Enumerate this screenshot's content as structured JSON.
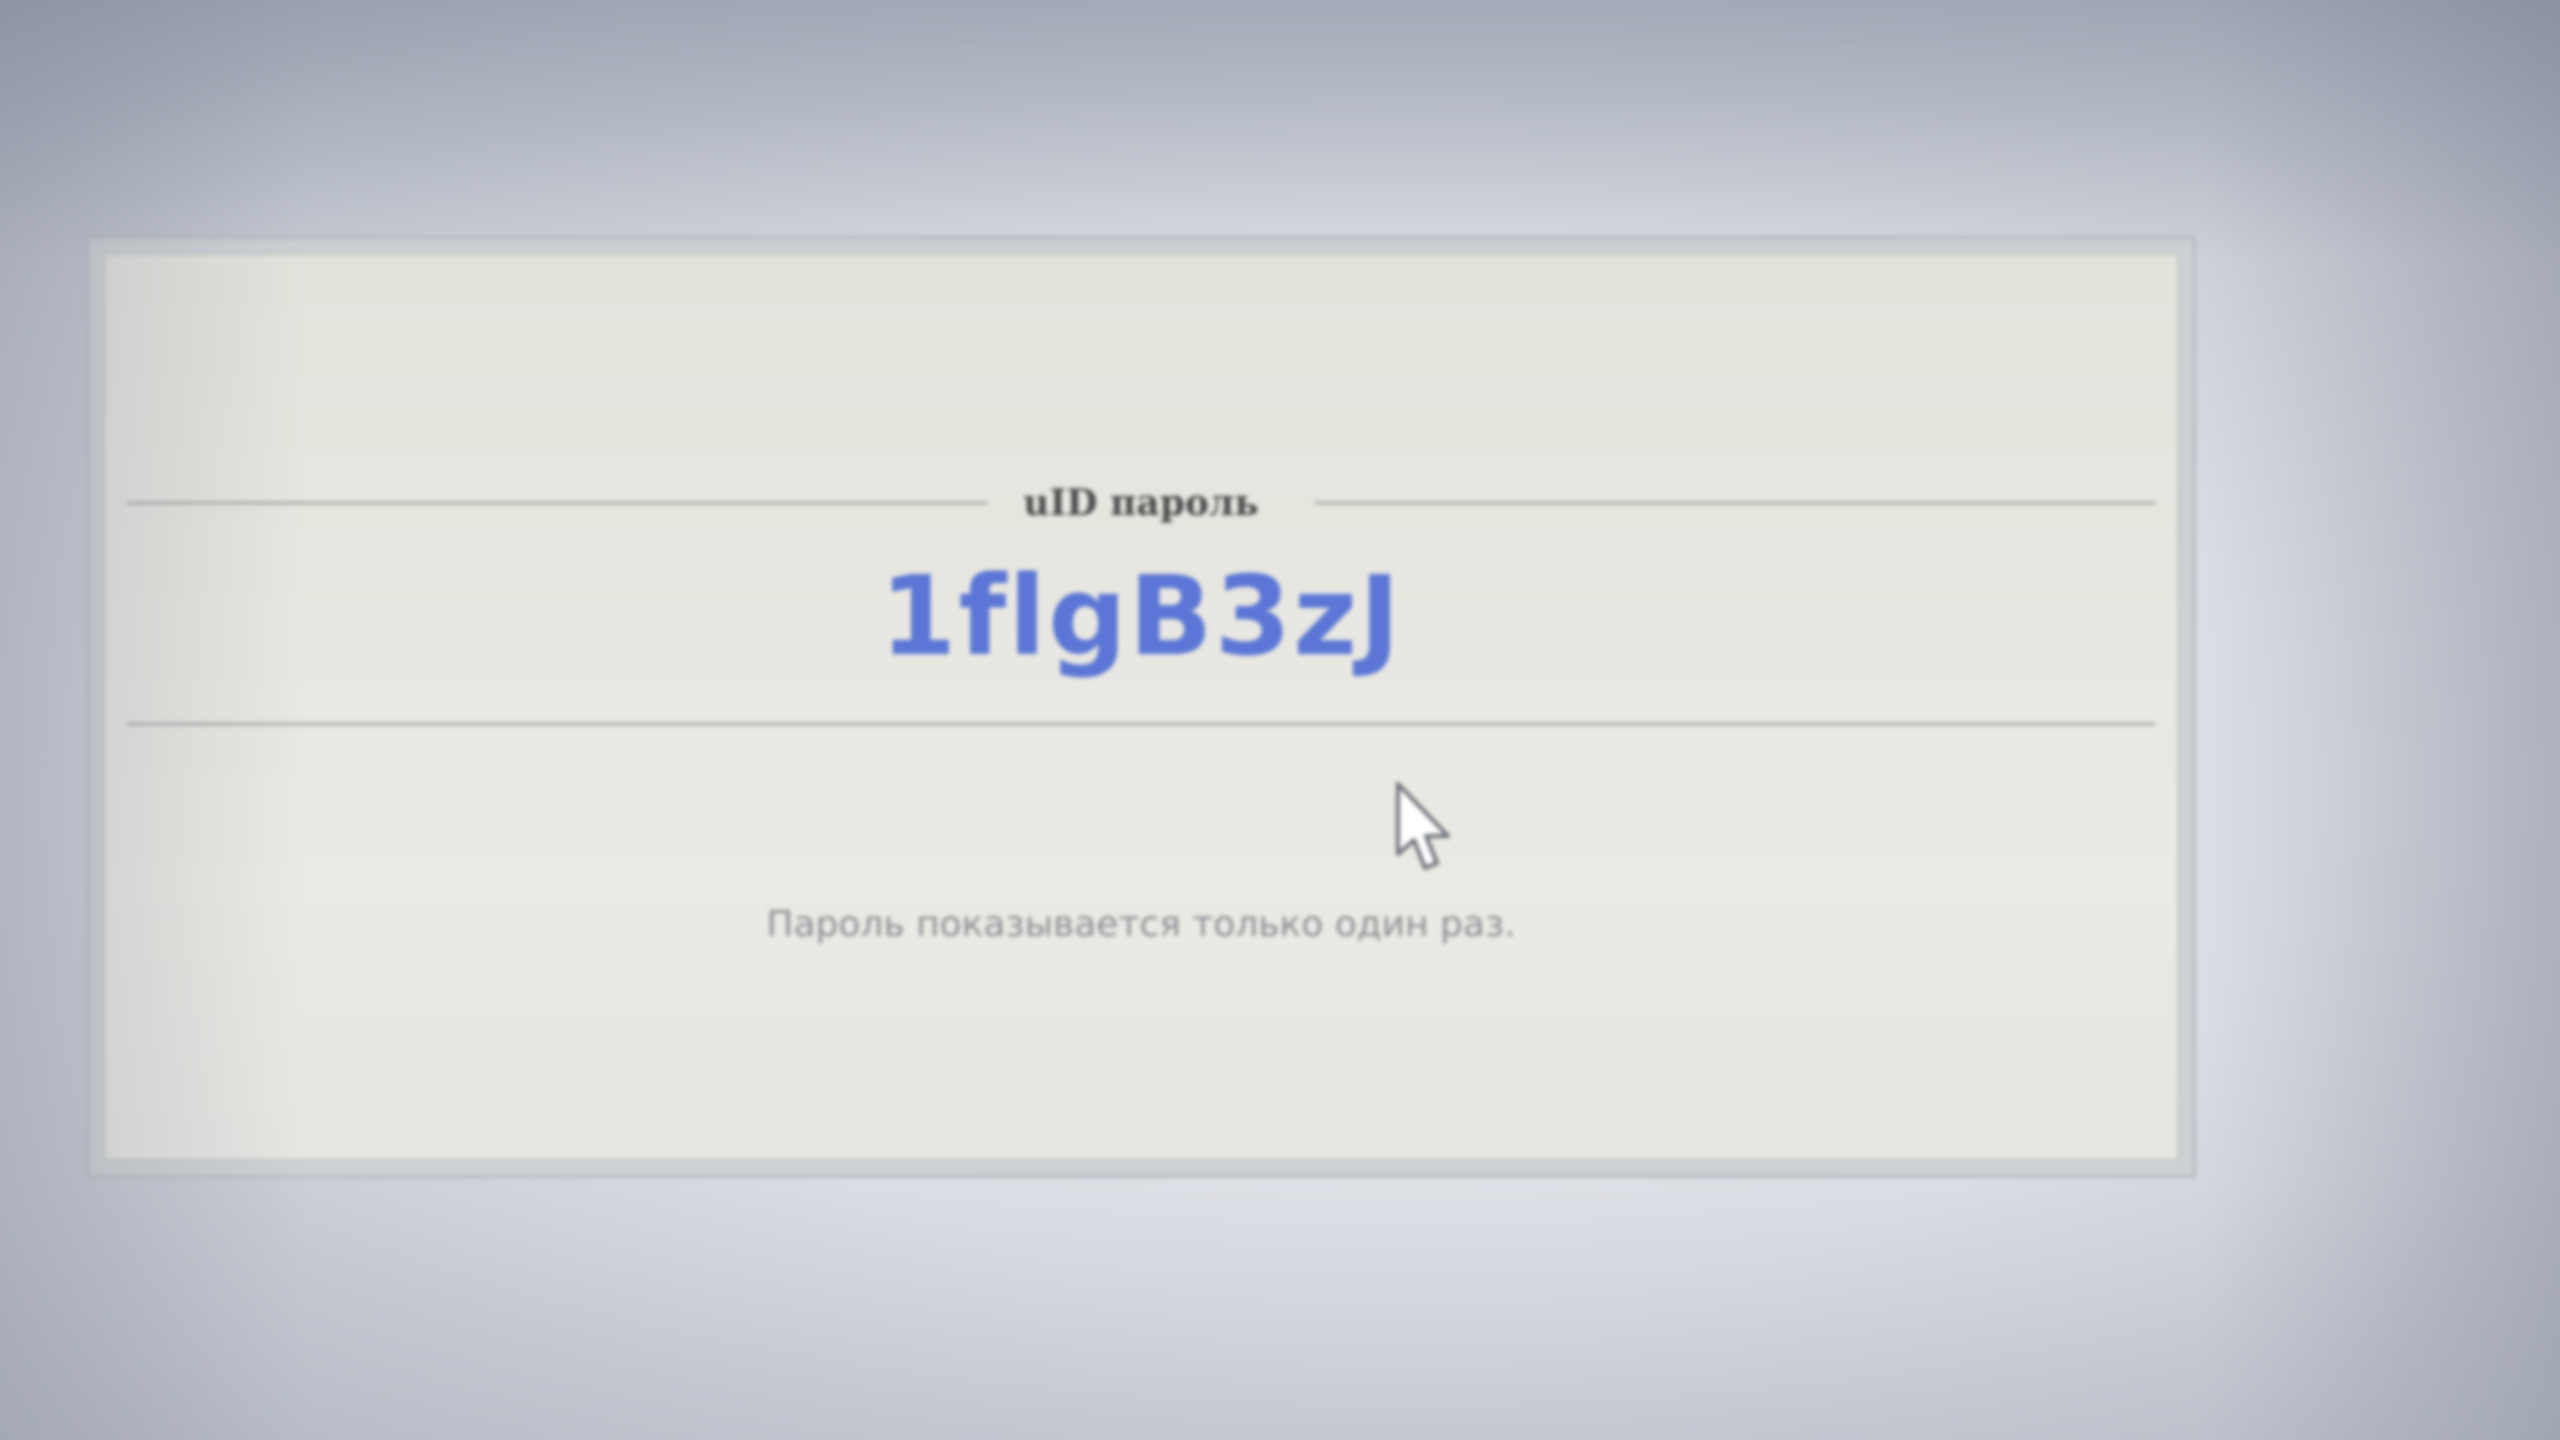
{
  "dialog": {
    "legend": "uID пароль",
    "password": "1flgB3zJ",
    "note": "Пароль показывается только один раз."
  },
  "cursor": {
    "icon": "arrow-pointer-icon"
  },
  "colors": {
    "password": "#5b76d6",
    "legend": "#4a4c4c",
    "note": "#8a8e93",
    "panel_background": "#e8e7e1"
  }
}
